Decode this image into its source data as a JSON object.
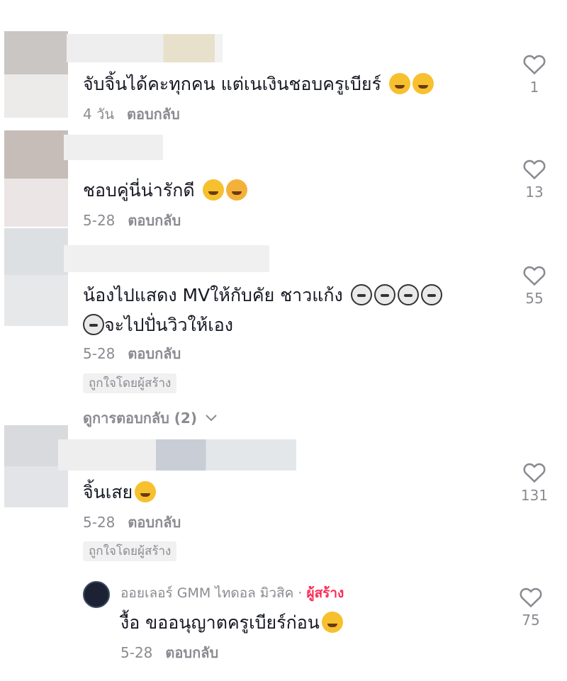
{
  "reply_label": "ตอบกลับ",
  "comments": [
    {
      "text": "จับจิ้นได้คะทุกคน แต่เนเงินชอบครูเบียร์",
      "time": "4 วัน",
      "likes": "1"
    },
    {
      "text": "ชอบคู่นี่น่ารักดี",
      "time": "5-28",
      "likes": "13"
    },
    {
      "text_line1": "น้องไปแสดง MVให้กับคัย ชาวแก้ง",
      "text_line2": "จะไปปั่นวิวให้เอง",
      "time": "5-28",
      "likes": "55",
      "badge": "ถูกใจโดยผู้สร้าง",
      "view_replies": "ดูการตอบกลับ (2)"
    },
    {
      "text": "จิ้นเสย",
      "time": "5-28",
      "likes": "131",
      "badge": "ถูกใจโดยผู้สร้าง"
    }
  ],
  "creator_reply": {
    "author": "ออยเลอร์ GMM ไทดอล มิวสิค",
    "separator": "·",
    "tag": "ผู้สร้าง",
    "text": "งื้อ ขออนุญาตครูเบียร์ก่อน",
    "time": "5-28",
    "likes": "75"
  },
  "icons": {
    "like": "heart-outline-icon",
    "chevron": "chevron-down-icon"
  },
  "colors": {
    "text": "#161823",
    "meta": "#8a8b91",
    "creator_tag": "#fe2c55"
  }
}
